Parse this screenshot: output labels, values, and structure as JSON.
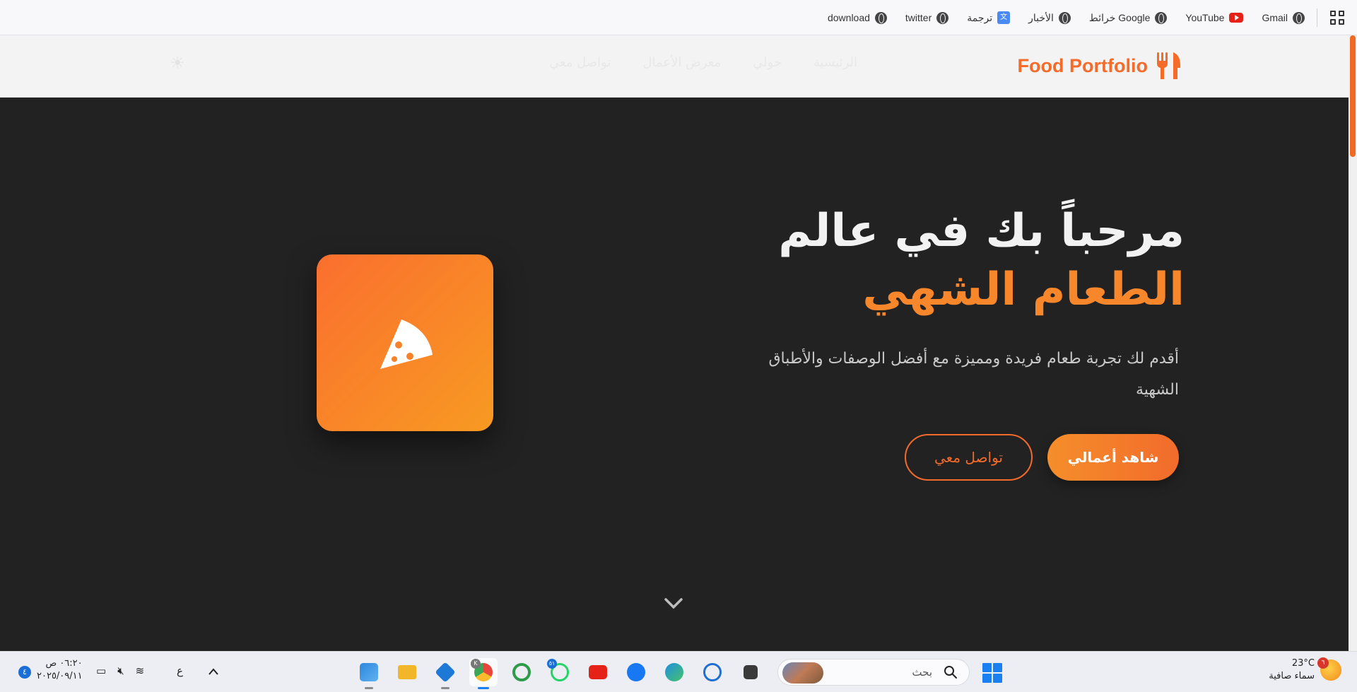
{
  "bookmarks": {
    "items": [
      {
        "label": "Gmail",
        "icon": "globe-icon"
      },
      {
        "label": "YouTube",
        "icon": "youtube-icon"
      },
      {
        "label": "خرائط Google",
        "icon": "globe-icon"
      },
      {
        "label": "الأخبار",
        "icon": "globe-icon"
      },
      {
        "label": "ترجمة",
        "icon": "translate-icon"
      },
      {
        "label": "twitter",
        "icon": "globe-icon"
      },
      {
        "label": "download",
        "icon": "globe-icon"
      }
    ]
  },
  "site": {
    "logo_text": "Food Portfolio",
    "logo_icon": "fork-knife-icon",
    "accent_color": "#f46b2a",
    "nav": [
      {
        "label": "الرئيسية"
      },
      {
        "label": "حولي"
      },
      {
        "label": "معرض الأعمال"
      },
      {
        "label": "تواصل معي"
      }
    ],
    "theme_icon": "sun-icon"
  },
  "hero": {
    "title_line1": "مرحباً بك في عالم",
    "title_line2": "الطعام الشهي",
    "description": "أقدم لك تجربة طعام فريدة ومميزة مع أفضل الوصفات والأطباق الشهية",
    "primary_button": "شاهد أعمالي",
    "secondary_button": "تواصل معي",
    "card_icon": "pizza-icon",
    "scroll_icon": "chevron-down-icon"
  },
  "taskbar": {
    "weather_temp": "23°C",
    "weather_desc": "سماء صافية",
    "weather_badge": "٦",
    "search_placeholder": "بحث",
    "apps": [
      {
        "name": "file-explorer",
        "color": "#3a3a3a"
      },
      {
        "name": "edge",
        "color": "#1f8fe0"
      },
      {
        "name": "facebook",
        "color": "#1877f2"
      },
      {
        "name": "youtube",
        "color": "#e62117"
      },
      {
        "name": "whatsapp",
        "color": "#25d366"
      },
      {
        "name": "app-green",
        "color": "#2e9b4a"
      },
      {
        "name": "chrome",
        "color": "#e8453c"
      },
      {
        "name": "vscode",
        "color": "#1e78d6"
      },
      {
        "name": "folder",
        "color": "#f2b62a"
      },
      {
        "name": "image-app",
        "color": "#2e86de"
      }
    ],
    "whatsapp_badge": "٥١",
    "chrome_badge": "K",
    "lang": "ع",
    "time": "٠٦:٢٠ ص",
    "date": "٢٠٢٥/٠٩/١١",
    "notification_count": "٤"
  }
}
